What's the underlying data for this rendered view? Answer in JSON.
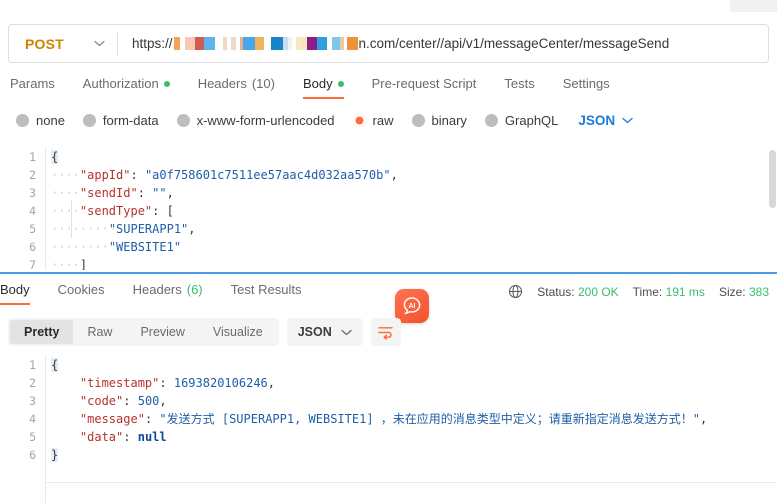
{
  "request": {
    "method": "POST",
    "url_prefix": "https://",
    "url_redacted_placeholder": "",
    "url_suffix": "n.com/center//api/v1/messageCenter/messageSend",
    "tabs": [
      {
        "label": "Params",
        "dot": false,
        "count": ""
      },
      {
        "label": "Authorization",
        "dot": true,
        "count": ""
      },
      {
        "label": "Headers",
        "dot": false,
        "count": "(10)"
      },
      {
        "label": "Body",
        "dot": true,
        "count": ""
      },
      {
        "label": "Pre-request Script",
        "dot": false,
        "count": ""
      },
      {
        "label": "Tests",
        "dot": false,
        "count": ""
      },
      {
        "label": "Settings",
        "dot": false,
        "count": ""
      }
    ],
    "active_tab": "Body",
    "body_types": [
      {
        "label": "none",
        "selected": false
      },
      {
        "label": "form-data",
        "selected": false
      },
      {
        "label": "x-www-form-urlencoded",
        "selected": false
      },
      {
        "label": "raw",
        "selected": true
      },
      {
        "label": "binary",
        "selected": false
      },
      {
        "label": "GraphQL",
        "selected": false
      }
    ],
    "raw_format": "JSON",
    "body_lines": [
      {
        "n": "1",
        "text": "{"
      },
      {
        "n": "2",
        "text": "    \"appId\": \"a0f758601c7511ee57aac4d032aa570b\","
      },
      {
        "n": "3",
        "text": "    \"sendId\": \"\","
      },
      {
        "n": "4",
        "text": "    \"sendType\": ["
      },
      {
        "n": "5",
        "text": "        \"SUPERAPP1\","
      },
      {
        "n": "6",
        "text": "        \"WEBSITE1\""
      },
      {
        "n": "7",
        "text": "    ]"
      }
    ],
    "body_json": {
      "appId": "a0f758601c7511ee57aac4d032aa570b",
      "sendId": "",
      "sendType": [
        "SUPERAPP1",
        "WEBSITE1"
      ]
    }
  },
  "response": {
    "tabs": [
      {
        "label": "Body",
        "count": ""
      },
      {
        "label": "Cookies",
        "count": ""
      },
      {
        "label": "Headers",
        "count": "(6)"
      },
      {
        "label": "Test Results",
        "count": ""
      }
    ],
    "active_tab": "Body",
    "status_label": "Status:",
    "status_value": "200 OK",
    "time_label": "Time:",
    "time_value": "191 ms",
    "size_label": "Size:",
    "size_value": "383",
    "ai_badge_text": "AI",
    "view_modes": [
      {
        "label": "Pretty",
        "active": true
      },
      {
        "label": "Raw",
        "active": false
      },
      {
        "label": "Preview",
        "active": false
      },
      {
        "label": "Visualize",
        "active": false
      }
    ],
    "format": "JSON",
    "body_lines": [
      {
        "n": "1",
        "text": "{"
      },
      {
        "n": "2",
        "text": "    \"timestamp\": 1693820106246,"
      },
      {
        "n": "3",
        "text": "    \"code\": 500,"
      },
      {
        "n": "4",
        "text": "    \"message\": \"发送方式 [SUPERAPP1, WEBSITE1] ，未在应用的消息类型中定义；请重新指定消息发送方式！\","
      },
      {
        "n": "5",
        "text": "    \"data\": null"
      },
      {
        "n": "6",
        "text": "}"
      }
    ],
    "body_json": {
      "timestamp": "1693820106246",
      "code": "500",
      "message": "发送方式 [SUPERAPP1, WEBSITE1] ，未在应用的消息类型中定义；请重新指定消息发送方式！",
      "data": "null"
    },
    "tokens": {
      "k_timestamp": "\"timestamp\"",
      "v_timestamp": "1693820106246",
      "k_code": "\"code\"",
      "v_code": "500",
      "k_message": "\"message\"",
      "v_message": "\"发送方式 [SUPERAPP1, WEBSITE1] ，未在应用的消息类型中定义；请重新指定消息发送方式！\"",
      "k_data": "\"data\"",
      "v_data": "null"
    }
  },
  "req_tokens": {
    "k_appId": "\"appId\"",
    "v_appId": "\"a0f758601c7511ee57aac4d032aa570b\"",
    "k_sendId": "\"sendId\"",
    "v_sendId": "\"\"",
    "k_sendType": "\"sendType\"",
    "v_superapp": "\"SUPERAPP1\"",
    "v_website": "\"WEBSITE1\""
  },
  "colors": {
    "accent": "#ff6c37",
    "success": "#3cbd6b",
    "link": "#1f7ae0",
    "method": "#ca8500",
    "splitter": "#4c9be8"
  }
}
